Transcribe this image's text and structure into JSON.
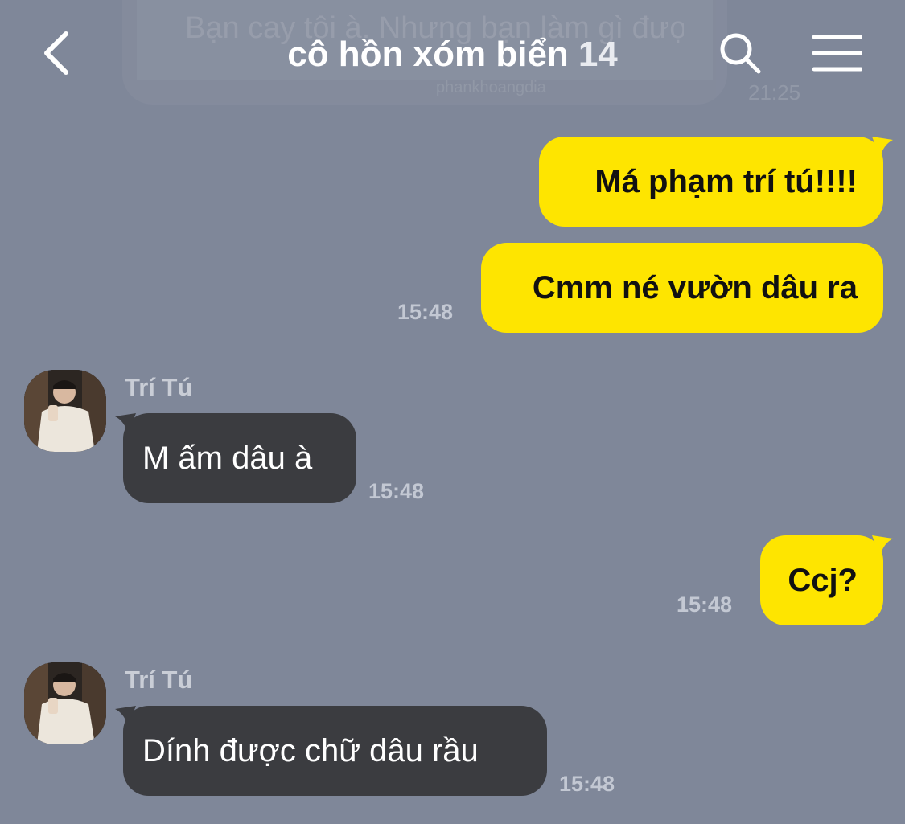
{
  "header": {
    "title": "cô hồn xóm biển",
    "member_count": "14",
    "back_icon": "chevron-left-icon",
    "search_icon": "search-icon",
    "menu_icon": "hamburger-menu-icon"
  },
  "pinned_ghost": {
    "text": "Bạn cay tôi à. Nhưng bạn làm gì được...",
    "sub": "phankhoangdia",
    "time": "21:25"
  },
  "colors": {
    "background": "#7f8799",
    "outgoing_bubble": "#fee500",
    "incoming_bubble": "#3b3c40",
    "timestamp": "#c3c8d3"
  },
  "messages": [
    {
      "direction": "outgoing",
      "text": "Má phạm trí tú!!!!"
    },
    {
      "direction": "outgoing",
      "text": "Cmm né vườn dâu ra",
      "time": "15:48"
    },
    {
      "direction": "incoming",
      "sender": "Trí Tú",
      "text": "M ấm dâu à",
      "time": "15:48"
    },
    {
      "direction": "outgoing",
      "text": "Ccj?",
      "time": "15:48"
    },
    {
      "direction": "incoming",
      "sender": "Trí Tú",
      "text": "Dính được chữ dâu rầu",
      "time": "15:48"
    }
  ]
}
